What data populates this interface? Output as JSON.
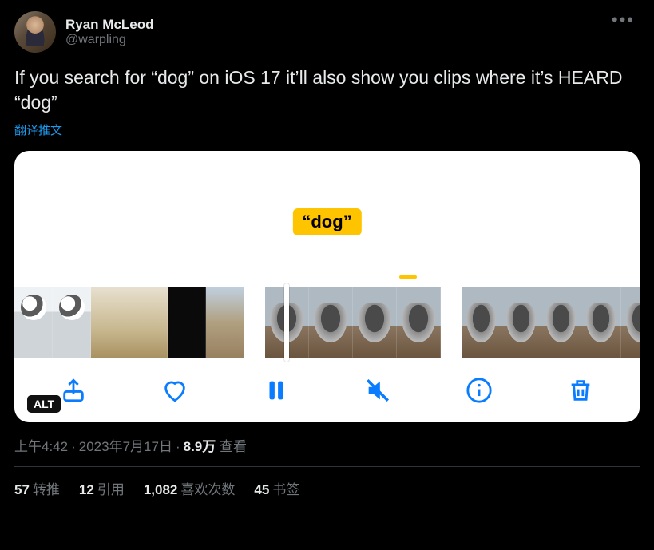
{
  "author": {
    "display_name": "Ryan McLeod",
    "handle": "@warpling"
  },
  "body_text": "If you search for “dog” on iOS 17 it’ll also show you clips where it’s HEARD “dog”",
  "translate_label": "翻译推文",
  "media": {
    "dog_label": "“dog”",
    "alt_badge": "ALT"
  },
  "meta": {
    "time": "上午4:42",
    "date": "2023年7月17日",
    "views_count": "8.9万",
    "views_label": "查看"
  },
  "stats": {
    "retweets": {
      "count": "57",
      "label": "转推"
    },
    "quotes": {
      "count": "12",
      "label": "引用"
    },
    "likes": {
      "count": "1,082",
      "label": "喜欢次数"
    },
    "bookmarks": {
      "count": "45",
      "label": "书签"
    }
  }
}
